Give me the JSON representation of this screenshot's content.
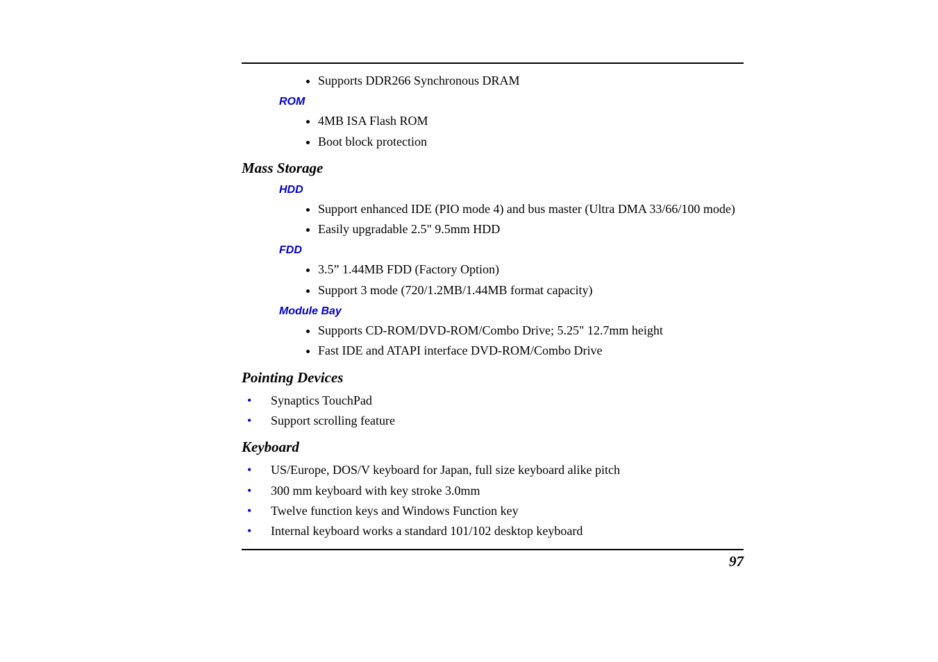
{
  "top_list": {
    "items": [
      "Supports DDR266 Synchronous DRAM"
    ]
  },
  "rom": {
    "heading": "ROM",
    "items": [
      "4MB ISA Flash ROM",
      "Boot block protection"
    ]
  },
  "mass_storage": {
    "heading": "Mass Storage",
    "hdd": {
      "heading": "HDD",
      "items": [
        "Support enhanced IDE (PIO mode 4) and bus master (Ultra DMA 33/66/100 mode)",
        "Easily upgradable 2.5\" 9.5mm HDD"
      ]
    },
    "fdd": {
      "heading": "FDD",
      "items": [
        "3.5” 1.44MB FDD (Factory Option)",
        "Support 3 mode (720/1.2MB/1.44MB format capacity)"
      ]
    },
    "module_bay": {
      "heading": "Module Bay",
      "items": [
        "Supports CD-ROM/DVD-ROM/Combo Drive; 5.25\" 12.7mm height",
        "Fast IDE and ATAPI interface DVD-ROM/Combo Drive"
      ]
    }
  },
  "pointing_devices": {
    "heading": "Pointing Devices",
    "items": [
      "Synaptics TouchPad",
      "Support scrolling feature"
    ]
  },
  "keyboard": {
    "heading": "Keyboard",
    "items": [
      "US/Europe, DOS/V keyboard for Japan, full size keyboard alike pitch",
      "300 mm keyboard with key stroke 3.0mm",
      "Twelve function keys and Windows Function key",
      "Internal keyboard works a standard 101/102 desktop keyboard"
    ]
  },
  "page_number": "97"
}
